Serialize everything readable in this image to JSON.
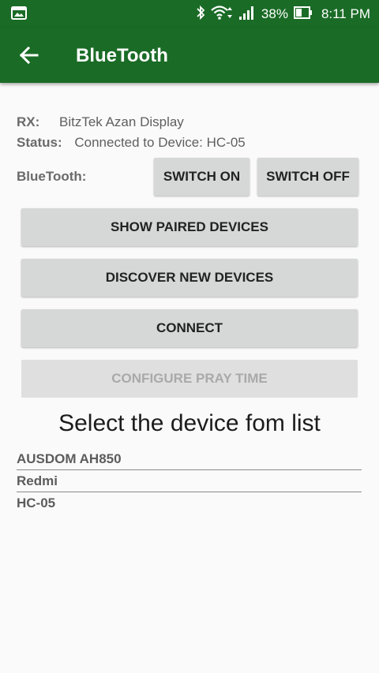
{
  "status_bar": {
    "battery_percent": "38%",
    "time": "8:11 PM"
  },
  "app_bar": {
    "title": "BlueTooth"
  },
  "info": {
    "rx_label": "RX:",
    "rx_value": "BitzTek Azan Display",
    "status_label": "Status:",
    "status_value": "Connected to Device: HC-05",
    "bluetooth_label": "BlueTooth:"
  },
  "buttons": {
    "switch_on": "SWITCH ON",
    "switch_off": "SWITCH OFF",
    "show_paired": "SHOW PAIRED DEVICES",
    "discover": "DISCOVER NEW DEVICES",
    "connect": "CONNECT",
    "configure": "CONFIGURE PRAY TIME"
  },
  "list": {
    "heading": "Select the device fom list",
    "devices": [
      "AUSDOM AH850",
      "Redmi",
      "HC-05"
    ]
  },
  "colors": {
    "primary": "#1a6b26",
    "button_bg": "#d6d7d7",
    "disabled_text": "#a9a9a9"
  }
}
